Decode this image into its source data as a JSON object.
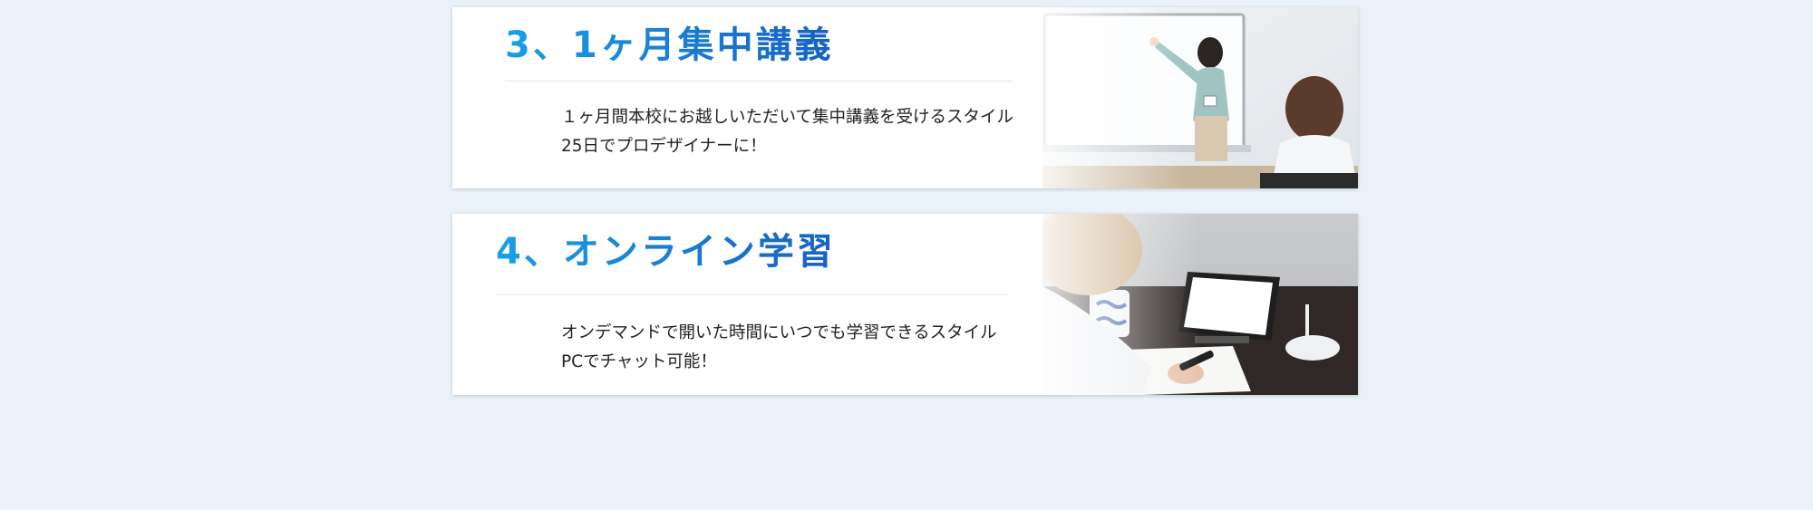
{
  "sections": [
    {
      "title": "3、1ヶ月集中講義",
      "lines": [
        "１ヶ月間本校にお越しいただいて集中講義を受けるスタイル",
        "25日でプロデザイナーに！"
      ],
      "image_alt": "classroom-lecture-photo"
    },
    {
      "title": "4、オンライン学習",
      "lines": [
        "オンデマンドで開いた時間にいつでも学習できるスタイル",
        "PCでチャット可能！"
      ],
      "image_alt": "online-study-photo"
    }
  ],
  "colors": {
    "page_background": "#eaf1f9",
    "title_gradient_start": "#19a0e6",
    "title_gradient_end": "#1561c2"
  }
}
